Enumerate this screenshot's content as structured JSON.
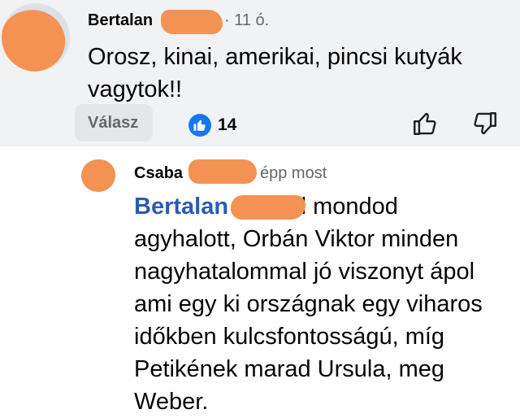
{
  "comment": {
    "author": "Bertalan",
    "time": "· 11 ó.",
    "text": "Orosz, kinai, amerikai, pincsi kutyák vagytok!!",
    "reply_label": "Válasz",
    "like_count": "14",
    "colors": {
      "like_blue": "#1877f2",
      "redaction": "#f49253"
    }
  },
  "reply": {
    "author": "Csaba",
    "time": "épp most",
    "mention": "Bertalan N",
    "text": "jól mondod agyhalott, Orbán Viktor minden nagyhatalommal jó viszonyt ápol ami egy ki országnak egy viharos időkben kulcsfontosságú, míg Petikének marad Ursula, meg Weber."
  },
  "icons": {
    "like_reaction": "thumbs-up-icon",
    "like_action": "thumb-up-icon",
    "dislike_action": "thumb-down-icon"
  }
}
